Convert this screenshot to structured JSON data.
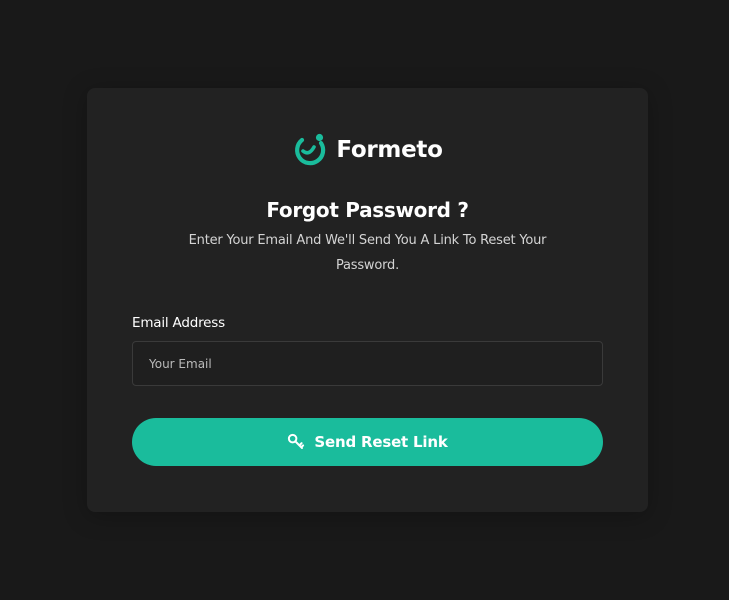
{
  "brand": {
    "name": "Formeto",
    "logo_icon": "brand-swirl-icon",
    "accent_color": "#1abc9c"
  },
  "page": {
    "heading": "Forgot Password ?",
    "subtitle": "Enter Your Email And We'll Send You A Link To Reset Your Password."
  },
  "form": {
    "email_label": "Email Address",
    "email_placeholder": "Your Email",
    "email_value": "",
    "submit_label": "Send Reset Link",
    "submit_icon": "key-icon"
  },
  "colors": {
    "background": "#191919",
    "card": "#222222",
    "accent": "#1abc9c"
  }
}
